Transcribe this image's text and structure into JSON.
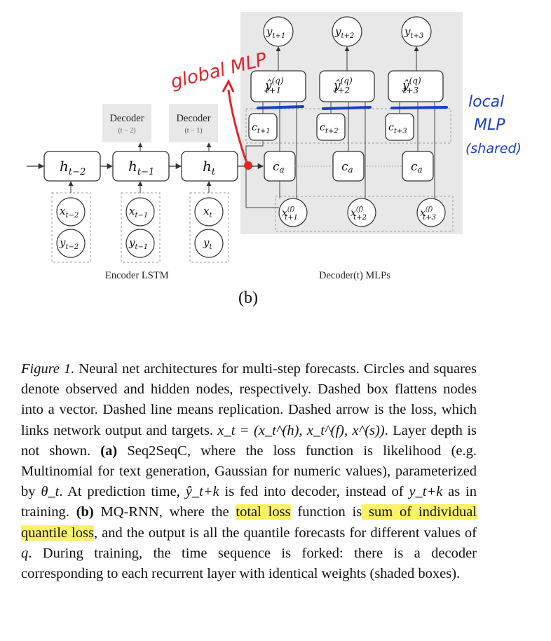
{
  "figure": {
    "panel_label": "(b)",
    "encoder_label": "Encoder LSTM",
    "decoder_label": "Decoder(t) MLPs",
    "decoder_boxes": [
      {
        "title": "Decoder",
        "sub": "(t − 2)"
      },
      {
        "title": "Decoder",
        "sub": "(t − 1)"
      }
    ],
    "hidden_states": [
      {
        "base": "h",
        "sub": "t−2"
      },
      {
        "base": "h",
        "sub": "t−1"
      },
      {
        "base": "h",
        "sub": "t"
      }
    ],
    "inputs": [
      {
        "x": "x",
        "x_sub": "t−2",
        "y": "y",
        "y_sub": "t−2"
      },
      {
        "x": "x",
        "x_sub": "t−1",
        "y": "y",
        "y_sub": "t−1"
      },
      {
        "x": "x",
        "x_sub": "t",
        "y": "y",
        "y_sub": "t"
      }
    ],
    "contexts": [
      {
        "base": "c",
        "sub": "t+1"
      },
      {
        "base": "c",
        "sub": "t+2"
      },
      {
        "base": "c",
        "sub": "t+3"
      }
    ],
    "ca_label": {
      "base": "c",
      "sub": "a"
    },
    "outputs": [
      {
        "y_sub": "t+1",
        "q": "(q)"
      },
      {
        "y_sub": "t+2",
        "q": "(q)"
      },
      {
        "y_sub": "t+3",
        "q": "(q)"
      }
    ],
    "future_inputs": [
      {
        "sup": "(f)",
        "sub": "t+1"
      },
      {
        "sup": "(f)",
        "sub": "t+2"
      },
      {
        "sup": "(f)",
        "sub": "t+3"
      }
    ],
    "annotations": {
      "global_mlp": "global MLP",
      "local_mlp": [
        "local",
        "MLP",
        "(shared)"
      ],
      "red_color": "#e0252b",
      "blue_color": "#1d3fc9"
    }
  },
  "caption": {
    "figure_ref": "Figure 1.",
    "part1": " Neural net architectures for multi-step forecasts. Circles and squares denote observed and hidden nodes, respectively. Dashed box flattens nodes into a vector. Dashed line means replication. Dashed arrow is the loss, which links network output and targets. ",
    "eq": "x_t = (x_t^(h), x_t^(f), x^(s))",
    "part2": ". Layer depth is not shown. ",
    "a_label": "(a)",
    "part3": " Seq2SeqC, where the loss function is likelihood (e.g. Multinomial for text generation, Gaussian for numeric values), parameterized by ",
    "theta": "θ_t",
    "part4": ". At prediction time, ",
    "yhat": "ŷ_t+k",
    "part5": " is fed into decoder, instead of ",
    "ytk": "y_t+k",
    "part6": " as in training. ",
    "b_label": "(b)",
    "part7": " MQ-RNN, where the ",
    "hl1": "total loss",
    "part8": " function is",
    "hl2": " sum of individual quantile loss",
    "part9": ", and the output is all the quantile forecasts for different values of ",
    "q": "q",
    "part10": ". During training, the time sequence is forked: there is a decoder corresponding to each recurrent layer with identical weights (shaded boxes).",
    "highlight_color": "#fbf26a"
  }
}
